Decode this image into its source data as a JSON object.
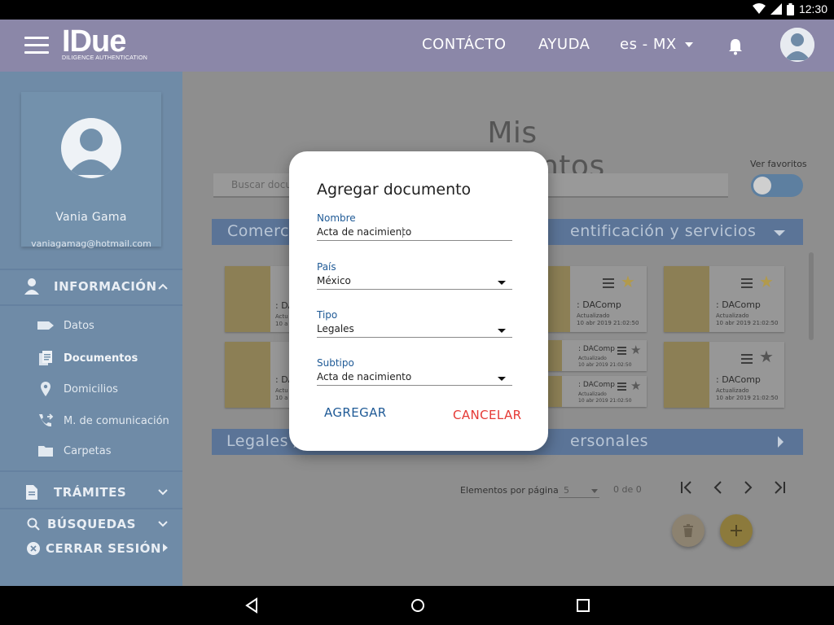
{
  "status_bar": {
    "time": "12:30"
  },
  "app_bar": {
    "logo": "IDue",
    "logo_subtitle": "DILIGENCE AUTHENTICATION",
    "contact": "CONTÁCTO",
    "help": "AYUDA",
    "language": "es - MX"
  },
  "sidebar": {
    "user_name": "Vania Gama",
    "user_email": "vaniagamag@hotmail.com",
    "info_section": "INFORMACIÓN",
    "items": [
      {
        "label": "Datos",
        "icon": "label-icon"
      },
      {
        "label": "Documentos",
        "icon": "documents-icon"
      },
      {
        "label": "Domicilios",
        "icon": "location-pin-icon"
      },
      {
        "label": "M. de comunicación",
        "icon": "phone-forward-icon"
      },
      {
        "label": "Carpetas",
        "icon": "folder-icon"
      }
    ],
    "procedures": "TRÁMITES",
    "searches": "BÚSQUEDAS",
    "logout": "CERRAR SESIÓN"
  },
  "main": {
    "title": "Mis documentos",
    "search_placeholder": "Buscar docu",
    "favorites_label": "Ver favoritos",
    "category_1_left": "Comerci",
    "category_1_right": "entificación y servicios",
    "category_2_left": "Legales /",
    "category_2_right": "ersonales",
    "doc_name": ": DAComp",
    "doc_partial": ": DA",
    "doc_updated": "Actualizado",
    "doc_date": "10 abr 2019 21:02:50",
    "doc_partial_updated": "Actu",
    "doc_partial_date": "10 a",
    "pager_label": "Elementos por página",
    "pager_size": "5",
    "pager_count": "0 de 0"
  },
  "dialog": {
    "title": "Agregar documento",
    "name_label": "Nombre",
    "name_value": "Acta de nacimiento",
    "country_label": "País",
    "country_value": "México",
    "type_label": "Tipo",
    "type_value": "Legales",
    "subtype_label": "Subtipo",
    "subtype_value": "Acta de nacimiento",
    "add_button": "AGREGAR",
    "cancel_button": "CANCELAR"
  },
  "colors": {
    "app_bar": "#8b87a8",
    "sidebar": "#6f8ba7",
    "dialog_accent": "#1f5a96",
    "cancel": "#e53935",
    "fab_add": "#d4b04a"
  }
}
